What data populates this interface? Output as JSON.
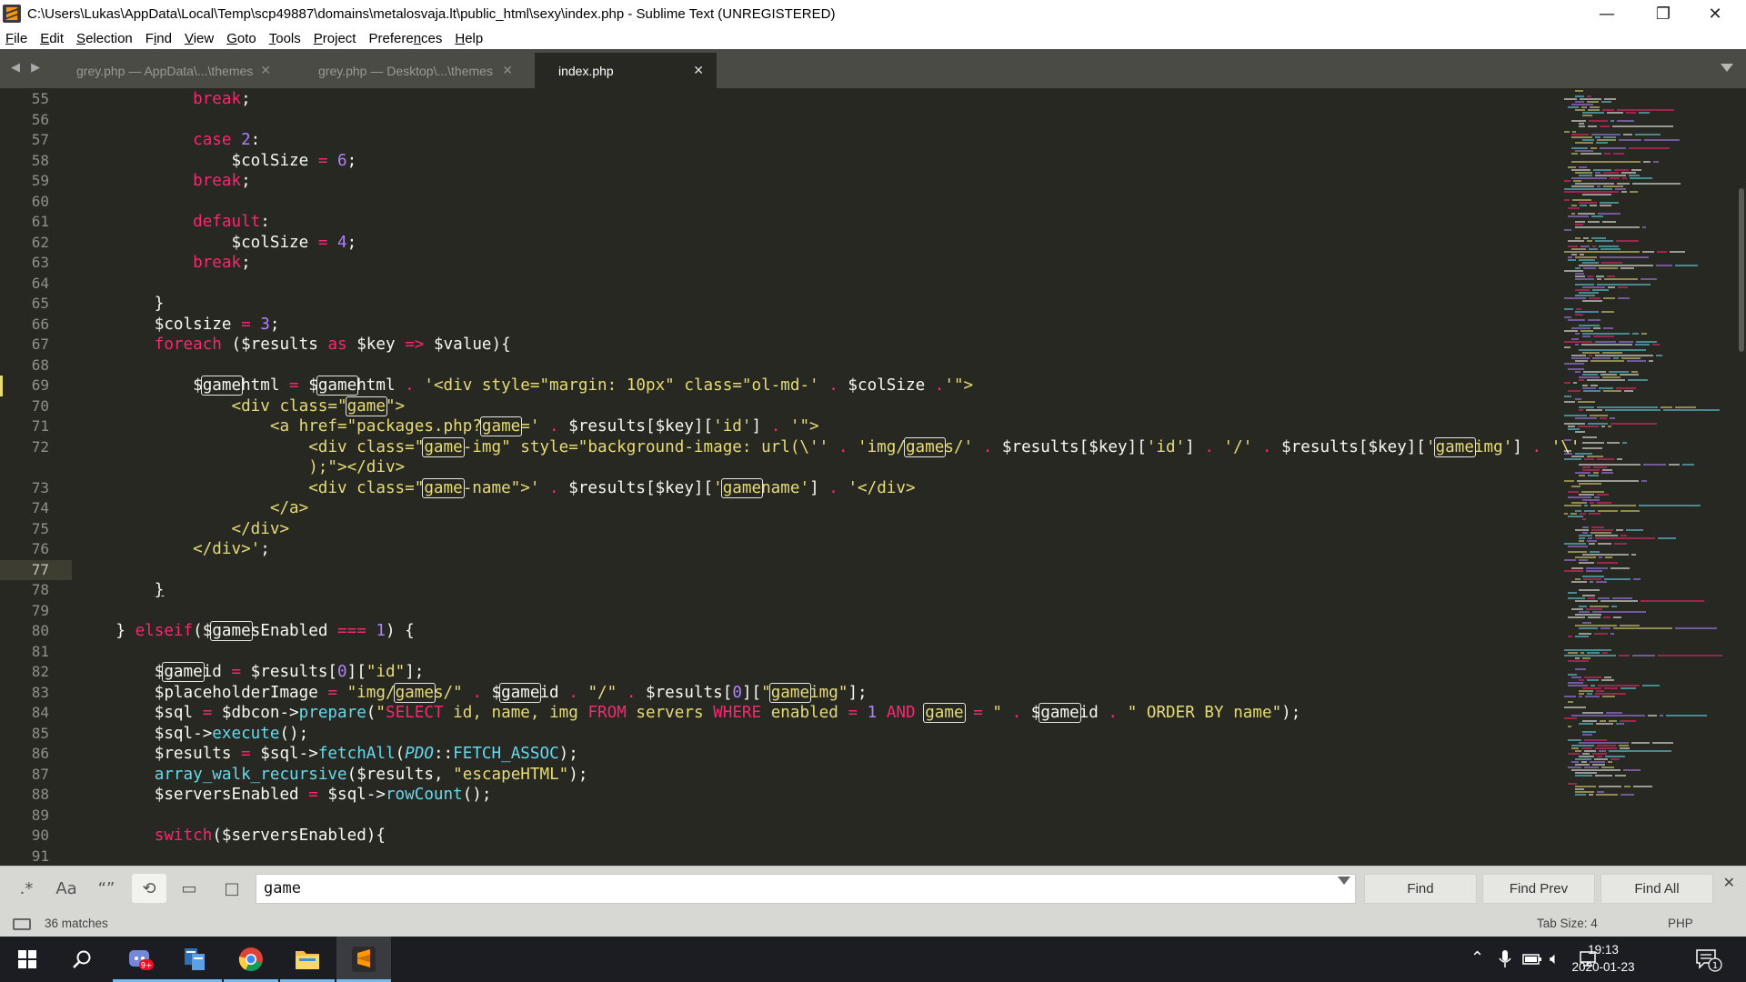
{
  "window": {
    "title": "C:\\Users\\Lukas\\AppData\\Local\\Temp\\scp49887\\domains\\metalosvaja.lt\\public_html\\sexy\\index.php - Sublime Text (UNREGISTERED)",
    "controls": {
      "minimize": "—",
      "maximize": "❐",
      "close": "✕"
    }
  },
  "menu": [
    {
      "pre": "",
      "u": "F",
      "post": "ile"
    },
    {
      "pre": "",
      "u": "E",
      "post": "dit"
    },
    {
      "pre": "",
      "u": "S",
      "post": "election"
    },
    {
      "pre": "F",
      "u": "i",
      "post": "nd"
    },
    {
      "pre": "",
      "u": "V",
      "post": "iew"
    },
    {
      "pre": "",
      "u": "G",
      "post": "oto"
    },
    {
      "pre": "",
      "u": "T",
      "post": "ools"
    },
    {
      "pre": "",
      "u": "P",
      "post": "roject"
    },
    {
      "pre": "Prefere",
      "u": "n",
      "post": "ces"
    },
    {
      "pre": "",
      "u": "H",
      "post": "elp"
    }
  ],
  "tabs": [
    {
      "label": "grey.php — AppData\\...\\themes",
      "close": "✕",
      "active": false
    },
    {
      "label": "grey.php — Desktop\\...\\themes",
      "close": "✕",
      "active": false
    },
    {
      "label": "index.php",
      "close": "✕",
      "active": true
    }
  ],
  "tab_nav": "◀ ▶",
  "editor": {
    "current_line": 77,
    "modified_line": 69,
    "lines": [
      {
        "n": "55",
        "html": "            <span class=\"kw\">break</span>;"
      },
      {
        "n": "56",
        "html": ""
      },
      {
        "n": "57",
        "html": "            <span class=\"kw\">case</span> <span class=\"num\">2</span>:"
      },
      {
        "n": "58",
        "html": "                $colSize <span class=\"kw\">=</span> <span class=\"num\">6</span>;"
      },
      {
        "n": "59",
        "html": "            <span class=\"kw\">break</span>;"
      },
      {
        "n": "60",
        "html": ""
      },
      {
        "n": "61",
        "html": "            <span class=\"kw\">default</span>:"
      },
      {
        "n": "62",
        "html": "                $colSize <span class=\"kw\">=</span> <span class=\"num\">4</span>;"
      },
      {
        "n": "63",
        "html": "            <span class=\"kw\">break</span>;"
      },
      {
        "n": "64",
        "html": ""
      },
      {
        "n": "65",
        "html": "        }"
      },
      {
        "n": "66",
        "html": "        $colsize <span class=\"kw\">=</span> <span class=\"num\">3</span>;"
      },
      {
        "n": "67",
        "html": "        <span class=\"kw\">foreach</span> ($results <span class=\"kw\">as</span> $key <span class=\"kw\">=&gt;</span> $value){"
      },
      {
        "n": "68",
        "html": ""
      },
      {
        "n": "69",
        "html": "            $<span class=\"hl\">game</span>html <span class=\"kw\">=</span> $<span class=\"hl\">game</span>html <span class=\"kw\">.</span> <span class=\"str\">'&lt;div style=\"margin: 10px\" class=\"ol-md-'</span> <span class=\"kw\">.</span> $colSize <span class=\"kw\">.</span><span class=\"str\">'\"&gt;</span>"
      },
      {
        "n": "70",
        "html": "<span class=\"str\">                &lt;div class=\"<span class=\"hl\">game</span>\"&gt;</span>"
      },
      {
        "n": "71",
        "html": "<span class=\"str\">                    &lt;a href=\"packages.php?<span class=\"hl\">game</span>='</span> <span class=\"kw\">.</span> $results[$key][<span class=\"str\">'id'</span>] <span class=\"kw\">.</span> <span class=\"str\">'\"&gt;</span>"
      },
      {
        "n": "72",
        "html": "<span class=\"str\">                        &lt;div class=\"<span class=\"hl\">game</span>-img\" style=\"background-image: url(\\''</span> <span class=\"kw\">.</span> <span class=\"str\">'img/<span class=\"hl\">game</span>s/'</span> <span class=\"kw\">.</span> $results[$key][<span class=\"str\">'id'</span>] <span class=\"kw\">.</span> <span class=\"str\">'/'</span> <span class=\"kw\">.</span> $results[$key][<span class=\"str\">'<span class=\"hl\">game</span>img'</span>] <span class=\"kw\">.</span> <span class=\"str\">'\\'</span>"
      },
      {
        "n": "",
        "html": "<span class=\"str\">                        );\"&gt;&lt;/div&gt;</span>"
      },
      {
        "n": "73",
        "html": "<span class=\"str\">                        &lt;div class=\"<span class=\"hl\">game</span>-name\"&gt;'</span> <span class=\"kw\">.</span> $results[$key][<span class=\"str\">'<span class=\"hl\">game</span>name'</span>] <span class=\"kw\">.</span> <span class=\"str\">'&lt;/div&gt;</span>"
      },
      {
        "n": "74",
        "html": "<span class=\"str\">                    &lt;/a&gt;</span>"
      },
      {
        "n": "75",
        "html": "<span class=\"str\">                &lt;/div&gt;</span>"
      },
      {
        "n": "76",
        "html": "<span class=\"str\">            &lt;/div&gt;'</span>;"
      },
      {
        "n": "77",
        "html": ""
      },
      {
        "n": "78",
        "html": "        <u>}</u>"
      },
      {
        "n": "79",
        "html": ""
      },
      {
        "n": "80",
        "html": "    } <span class=\"kw\">elseif</span>($<span class=\"hl\">game</span>sEnabled <span class=\"kw\">===</span> <span class=\"num\">1</span>) {"
      },
      {
        "n": "81",
        "html": ""
      },
      {
        "n": "82",
        "html": "        $<span class=\"hl\">game</span>id <span class=\"kw\">=</span> $results[<span class=\"num\">0</span>][<span class=\"str\">\"id\"</span>];"
      },
      {
        "n": "83",
        "html": "        $placeholderImage <span class=\"kw\">=</span> <span class=\"str\">\"img/<span class=\"hl\">game</span>s/\"</span> <span class=\"kw\">.</span> $<span class=\"hl\">game</span>id <span class=\"kw\">.</span> <span class=\"str\">\"/\"</span> <span class=\"kw\">.</span> $results[<span class=\"num\">0</span>][<span class=\"str\">\"<span class=\"hl\">game</span>img\"</span>];"
      },
      {
        "n": "84",
        "html": "        $sql <span class=\"kw\">=</span> $dbcon-&gt;<span class=\"fn\">prepare</span>(<span class=\"str\">\"</span><span class=\"kw\">SELECT</span><span class=\"str\"> id, name, img </span><span class=\"kw\">FROM</span><span class=\"str\"> servers </span><span class=\"kw\">WHERE</span><span class=\"str\"> enabled </span><span class=\"kw\">=</span><span class=\"str\"> </span><span class=\"num\">1</span><span class=\"str\"> </span><span class=\"kw\">AND</span><span class=\"str\"> <span class=\"hl\">game</span> </span><span class=\"kw\">=</span><span class=\"str\"> \"</span> <span class=\"kw\">.</span> $<span class=\"hl\">game</span>id <span class=\"kw\">.</span> <span class=\"str\">\" ORDER BY name\"</span>);"
      },
      {
        "n": "85",
        "html": "        $sql-&gt;<span class=\"fn\">execute</span>();"
      },
      {
        "n": "86",
        "html": "        $results <span class=\"kw\">=</span> $sql-&gt;<span class=\"fn\">fetchAll</span>(<span class=\"it\">PDO</span>::<span class=\"fn\">FETCH_ASSOC</span>);"
      },
      {
        "n": "87",
        "html": "        <span class=\"fn\">array_walk_recursive</span>($results, <span class=\"str\">\"escapeHTML\"</span>);"
      },
      {
        "n": "88",
        "html": "        $serversEnabled <span class=\"kw\">=</span> $sql-&gt;<span class=\"fn\">rowCount</span>();"
      },
      {
        "n": "89",
        "html": ""
      },
      {
        "n": "90",
        "html": "        <span class=\"kw\">switch</span>($serversEnabled){"
      },
      {
        "n": "91",
        "html": ""
      }
    ]
  },
  "find": {
    "query": "game",
    "options": [
      {
        "name": "regex-toggle",
        "glyph": ".*",
        "on": false
      },
      {
        "name": "case-sensitive-toggle",
        "glyph": "Aa",
        "on": false
      },
      {
        "name": "whole-word-toggle",
        "glyph": "“”",
        "on": false
      },
      {
        "name": "wrap-toggle",
        "glyph": "⟲",
        "on": true
      },
      {
        "name": "in-selection-toggle",
        "glyph": "▭",
        "on": false
      },
      {
        "name": "highlight-matches-toggle",
        "glyph": "□",
        "on": false
      }
    ],
    "buttons": {
      "find": "Find",
      "find_prev": "Find Prev",
      "find_all": "Find All"
    },
    "close": "✕"
  },
  "status": {
    "matches": "36 matches",
    "tab_size": "Tab Size: 4",
    "syntax": "PHP"
  },
  "taskbar": {
    "apps": [
      {
        "name": "start-button",
        "icon": "windows-icon"
      },
      {
        "name": "search-button",
        "icon": "search-icon"
      },
      {
        "name": "taskbar-app-discord",
        "icon": "chat-icon",
        "badge": "9+"
      },
      {
        "name": "taskbar-app-transfer",
        "icon": "winscp-icon"
      },
      {
        "name": "taskbar-app-chrome",
        "icon": "chrome-icon"
      },
      {
        "name": "taskbar-app-explorer",
        "icon": "folder-icon"
      },
      {
        "name": "taskbar-app-sublime",
        "icon": "sublime-icon"
      }
    ],
    "time": "19:13",
    "date": "2020-01-23",
    "notification_count": "1"
  },
  "colors": {
    "bg": "#272822",
    "keyword": "#f92672",
    "string": "#e6db74",
    "number": "#ae81ff",
    "function": "#66d9ef"
  }
}
